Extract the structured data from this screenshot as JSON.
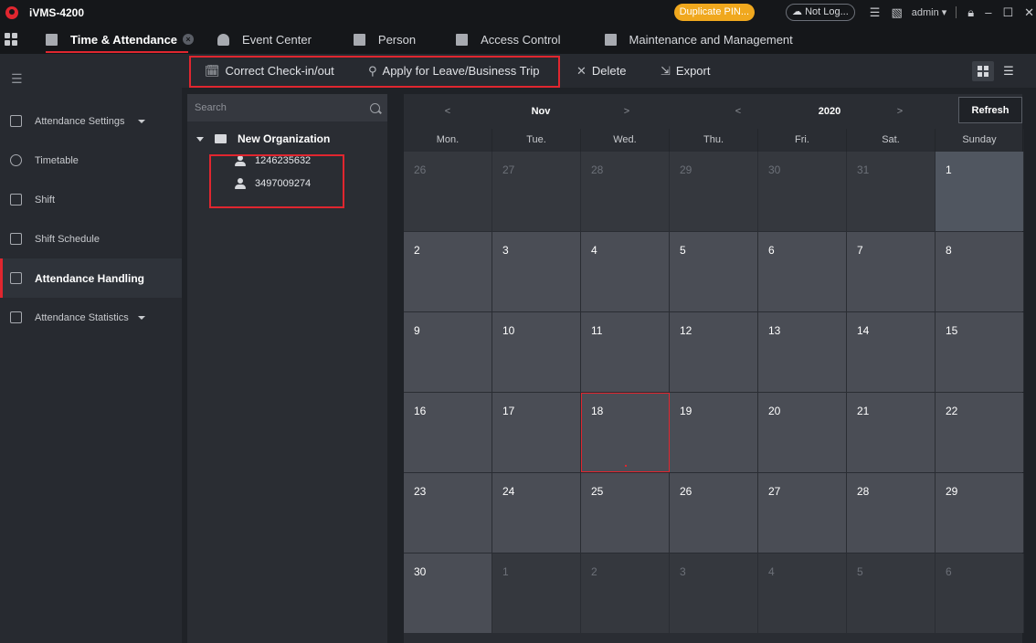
{
  "titlebar": {
    "app_title": "iVMS-4200",
    "duplicate_pin": "Duplicate PIN...",
    "cloud_status": "Not Log...",
    "user": "admin"
  },
  "module_tabs": [
    {
      "label": "Time & Attendance",
      "active": true
    },
    {
      "label": "Event Center"
    },
    {
      "label": "Person"
    },
    {
      "label": "Access Control"
    },
    {
      "label": "Maintenance and Management"
    }
  ],
  "sidebar": {
    "items": [
      {
        "label": "Attendance Settings",
        "icon": "calendar-grid-icon",
        "expandable": true
      },
      {
        "label": "Timetable",
        "icon": "clock-icon"
      },
      {
        "label": "Shift",
        "icon": "shift-icon"
      },
      {
        "label": "Shift Schedule",
        "icon": "schedule-icon"
      },
      {
        "label": "Attendance Handling",
        "icon": "handling-icon",
        "active": true
      },
      {
        "label": "Attendance Statistics",
        "icon": "statistics-icon",
        "expandable": true
      }
    ]
  },
  "toolbar": {
    "correct_label": "Correct Check-in/out",
    "apply_leave_label": "Apply for Leave/Business Trip",
    "delete_label": "Delete",
    "export_label": "Export"
  },
  "tree": {
    "search_placeholder": "Search",
    "org_name": "New Organization",
    "persons": [
      "1246235632",
      "3497009274"
    ]
  },
  "calendar": {
    "prev_month": "<",
    "month": "Nov",
    "next_month": ">",
    "prev_year": "<",
    "year": "2020",
    "next_year": ">",
    "refresh_label": "Refresh",
    "weekdays": [
      "Mon.",
      "Tue.",
      "Wed.",
      "Thu.",
      "Fri.",
      "Sat.",
      "Sunday"
    ],
    "weeks": [
      [
        "26",
        "27",
        "28",
        "29",
        "30",
        "31",
        "1"
      ],
      [
        "2",
        "3",
        "4",
        "5",
        "6",
        "7",
        "8"
      ],
      [
        "9",
        "10",
        "11",
        "12",
        "13",
        "14",
        "15"
      ],
      [
        "16",
        "17",
        "18",
        "19",
        "20",
        "21",
        "22"
      ],
      [
        "23",
        "24",
        "25",
        "26",
        "27",
        "28",
        "29"
      ],
      [
        "30",
        "1",
        "2",
        "3",
        "4",
        "5",
        "6"
      ]
    ],
    "selected_day": "18"
  },
  "colors": {
    "accent_red": "#e0262f",
    "badge_orange": "#f0a81e"
  }
}
